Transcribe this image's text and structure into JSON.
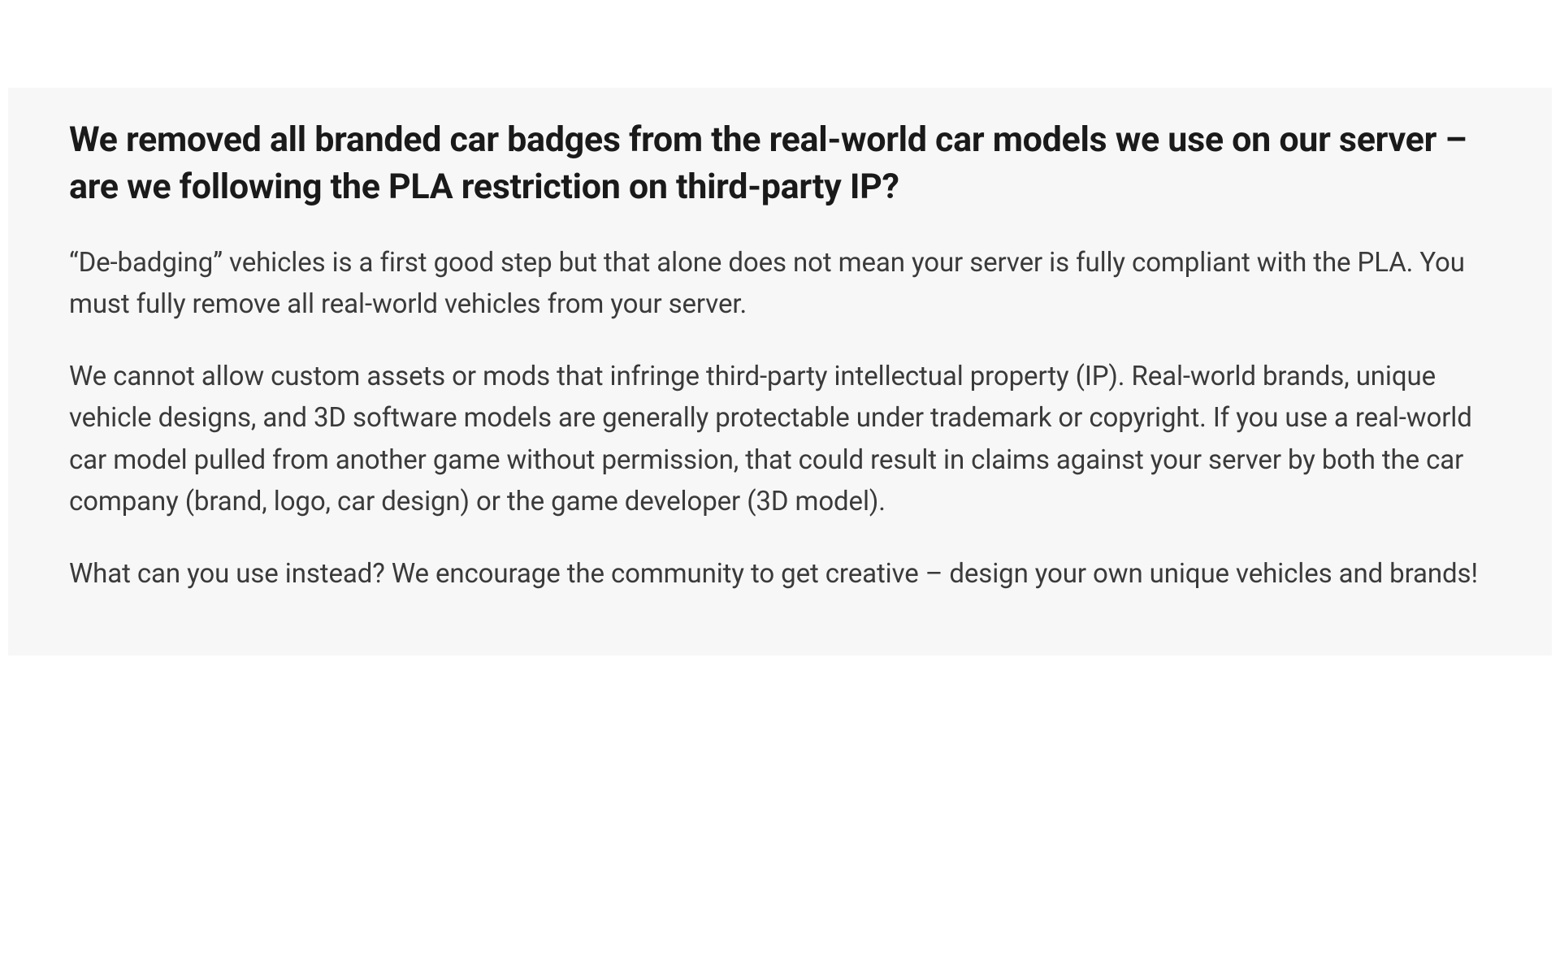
{
  "article": {
    "heading": "We removed all branded car badges from the real-world car models we use on our server – are we following the PLA restriction on third-party IP?",
    "paragraphs": [
      "“De-badging” vehicles is a first good step but that alone does not mean your server is fully compliant with the PLA. You must fully remove all real-world vehicles from your server.",
      "We cannot allow custom assets or mods that infringe third-party intellectual property (IP). Real-world brands, unique vehicle designs, and 3D software models are generally protectable under trademark or copyright. If you use a real-world car model pulled from another game without permission, that could result in claims against your server by both the car company (brand, logo, car design) or the game developer (3D model).",
      "What can you use instead? We encourage the community to get creative – design your own unique vehicles and brands!"
    ]
  }
}
